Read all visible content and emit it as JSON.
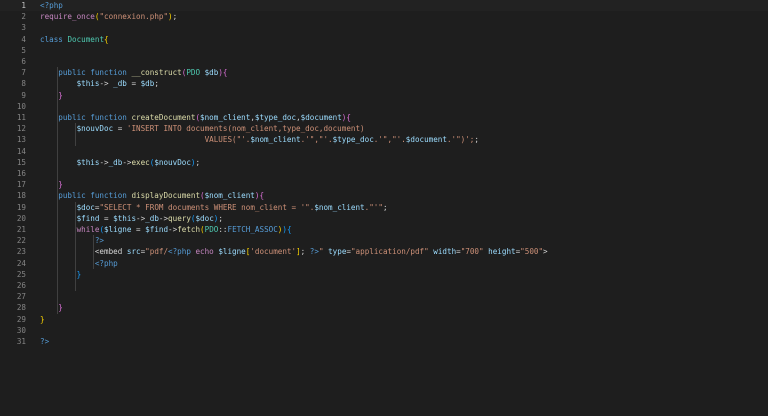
{
  "editor": {
    "language": "php",
    "active_line": 1,
    "colors": {
      "background": "#1e1e1e",
      "line_number": "#858585",
      "keyword": "#569cd6",
      "function": "#dcdcaa",
      "variable": "#9cdcfe",
      "string": "#ce9178",
      "control": "#c586c0"
    },
    "lines": [
      {
        "n": "1",
        "segments": [
          {
            "t": "<?php",
            "c": "kw"
          }
        ]
      },
      {
        "n": "2",
        "segments": [
          {
            "t": "require_once",
            "c": "ctl"
          },
          {
            "t": "(",
            "c": "br1"
          },
          {
            "t": "\"connexion.php\"",
            "c": "str"
          },
          {
            "t": ")",
            "c": "br1"
          },
          {
            "t": ";",
            "c": "pl"
          }
        ]
      },
      {
        "n": "3",
        "segments": []
      },
      {
        "n": "4",
        "segments": [
          {
            "t": "class ",
            "c": "kw"
          },
          {
            "t": "Document",
            "c": "cls"
          },
          {
            "t": "{",
            "c": "br1"
          }
        ]
      },
      {
        "n": "5",
        "segments": []
      },
      {
        "n": "6",
        "segments": []
      },
      {
        "n": "7",
        "segments": [
          {
            "t": "    public function ",
            "c": "kw"
          },
          {
            "t": "__construct",
            "c": "fn"
          },
          {
            "t": "(",
            "c": "br2"
          },
          {
            "t": "PDO ",
            "c": "cls"
          },
          {
            "t": "$db",
            "c": "var"
          },
          {
            "t": "){",
            "c": "br2"
          }
        ]
      },
      {
        "n": "8",
        "segments": [
          {
            "t": "        $this",
            "c": "var"
          },
          {
            "t": "-> ",
            "c": "op"
          },
          {
            "t": "_db",
            "c": "var"
          },
          {
            "t": " = ",
            "c": "op"
          },
          {
            "t": "$db",
            "c": "var"
          },
          {
            "t": ";",
            "c": "pl"
          }
        ]
      },
      {
        "n": "9",
        "segments": [
          {
            "t": "    }",
            "c": "br2"
          }
        ]
      },
      {
        "n": "10",
        "segments": []
      },
      {
        "n": "11",
        "segments": [
          {
            "t": "    public function ",
            "c": "kw"
          },
          {
            "t": "createDocument",
            "c": "fn"
          },
          {
            "t": "(",
            "c": "br2"
          },
          {
            "t": "$nom_client",
            "c": "var"
          },
          {
            "t": ",",
            "c": "pl"
          },
          {
            "t": "$type_doc",
            "c": "var"
          },
          {
            "t": ",",
            "c": "pl"
          },
          {
            "t": "$document",
            "c": "var"
          },
          {
            "t": "){",
            "c": "br2"
          }
        ]
      },
      {
        "n": "12",
        "segments": [
          {
            "t": "        $nouvDoc",
            "c": "var"
          },
          {
            "t": " = ",
            "c": "op"
          },
          {
            "t": "'INSERT INTO documents(nom_client,type_doc,document)",
            "c": "str"
          }
        ]
      },
      {
        "n": "13",
        "segments": [
          {
            "t": "                                    VALUES(\"'.",
            "c": "str"
          },
          {
            "t": "$nom_client",
            "c": "var"
          },
          {
            "t": ".'\",\"'.",
            "c": "str"
          },
          {
            "t": "$type_doc",
            "c": "var"
          },
          {
            "t": ".'\",\"'.",
            "c": "str"
          },
          {
            "t": "$document",
            "c": "var"
          },
          {
            "t": ".'\")';",
            "c": "str"
          },
          {
            "t": ";",
            "c": "pl"
          }
        ]
      },
      {
        "n": "14",
        "segments": []
      },
      {
        "n": "15",
        "segments": [
          {
            "t": "        $this",
            "c": "var"
          },
          {
            "t": "->",
            "c": "op"
          },
          {
            "t": "_db",
            "c": "var"
          },
          {
            "t": "->",
            "c": "op"
          },
          {
            "t": "exec",
            "c": "fn"
          },
          {
            "t": "(",
            "c": "br3"
          },
          {
            "t": "$nouvDoc",
            "c": "var"
          },
          {
            "t": ")",
            "c": "br3"
          },
          {
            "t": ";",
            "c": "pl"
          }
        ]
      },
      {
        "n": "16",
        "segments": []
      },
      {
        "n": "17",
        "segments": [
          {
            "t": "    }",
            "c": "br2"
          }
        ]
      },
      {
        "n": "18",
        "segments": [
          {
            "t": "    public function ",
            "c": "kw"
          },
          {
            "t": "displayDocument",
            "c": "fn"
          },
          {
            "t": "(",
            "c": "br2"
          },
          {
            "t": "$nom_client",
            "c": "var"
          },
          {
            "t": "){",
            "c": "br2"
          }
        ]
      },
      {
        "n": "19",
        "segments": [
          {
            "t": "        $doc",
            "c": "var"
          },
          {
            "t": "=",
            "c": "op"
          },
          {
            "t": "\"SELECT * FROM documents WHERE nom_client = '\".",
            "c": "str"
          },
          {
            "t": "$nom_client",
            "c": "var"
          },
          {
            "t": ".\"'\"",
            "c": "str"
          },
          {
            "t": ";",
            "c": "pl"
          }
        ]
      },
      {
        "n": "20",
        "segments": [
          {
            "t": "        $find",
            "c": "var"
          },
          {
            "t": " = ",
            "c": "op"
          },
          {
            "t": "$this",
            "c": "var"
          },
          {
            "t": "->",
            "c": "op"
          },
          {
            "t": "_db",
            "c": "var"
          },
          {
            "t": "->",
            "c": "op"
          },
          {
            "t": "query",
            "c": "fn"
          },
          {
            "t": "(",
            "c": "br3"
          },
          {
            "t": "$doc",
            "c": "var"
          },
          {
            "t": ")",
            "c": "br3"
          },
          {
            "t": ";",
            "c": "pl"
          }
        ]
      },
      {
        "n": "21",
        "segments": [
          {
            "t": "        while",
            "c": "ctl"
          },
          {
            "t": "(",
            "c": "br3"
          },
          {
            "t": "$ligne",
            "c": "var"
          },
          {
            "t": " = ",
            "c": "op"
          },
          {
            "t": "$find",
            "c": "var"
          },
          {
            "t": "->",
            "c": "op"
          },
          {
            "t": "fetch",
            "c": "fn"
          },
          {
            "t": "(",
            "c": "br1"
          },
          {
            "t": "PDO",
            "c": "cls"
          },
          {
            "t": "::",
            "c": "op"
          },
          {
            "t": "FETCH_ASSOC",
            "c": "kw"
          },
          {
            "t": ")",
            "c": "br1"
          },
          {
            "t": ")",
            "c": "br3"
          },
          {
            "t": "{",
            "c": "br3"
          }
        ]
      },
      {
        "n": "22",
        "segments": [
          {
            "t": "            ?>",
            "c": "kw"
          }
        ]
      },
      {
        "n": "23",
        "segments": [
          {
            "t": "            <embed ",
            "c": "pl"
          },
          {
            "t": "src",
            "c": "var"
          },
          {
            "t": "=",
            "c": "op"
          },
          {
            "t": "\"pdf/",
            "c": "str"
          },
          {
            "t": "<?php ",
            "c": "kw"
          },
          {
            "t": "echo ",
            "c": "ctl"
          },
          {
            "t": "$ligne",
            "c": "var"
          },
          {
            "t": "[",
            "c": "br1"
          },
          {
            "t": "'document'",
            "c": "str"
          },
          {
            "t": "]",
            "c": "br1"
          },
          {
            "t": "; ",
            "c": "pl"
          },
          {
            "t": "?>",
            "c": "kw"
          },
          {
            "t": "\" ",
            "c": "str"
          },
          {
            "t": "type",
            "c": "var"
          },
          {
            "t": "=",
            "c": "op"
          },
          {
            "t": "\"application/pdf\" ",
            "c": "str"
          },
          {
            "t": "width",
            "c": "var"
          },
          {
            "t": "=",
            "c": "op"
          },
          {
            "t": "\"700\" ",
            "c": "str"
          },
          {
            "t": "height",
            "c": "var"
          },
          {
            "t": "=",
            "c": "op"
          },
          {
            "t": "\"500\"",
            "c": "str"
          },
          {
            "t": ">",
            "c": "pl"
          }
        ]
      },
      {
        "n": "24",
        "segments": [
          {
            "t": "            <?php",
            "c": "kw"
          }
        ]
      },
      {
        "n": "25",
        "segments": [
          {
            "t": "        }",
            "c": "br3"
          }
        ]
      },
      {
        "n": "26",
        "segments": []
      },
      {
        "n": "27",
        "segments": []
      },
      {
        "n": "28",
        "segments": [
          {
            "t": "    }",
            "c": "br2"
          }
        ]
      },
      {
        "n": "29",
        "segments": [
          {
            "t": "}",
            "c": "br1"
          }
        ]
      },
      {
        "n": "30",
        "segments": []
      },
      {
        "n": "31",
        "segments": [
          {
            "t": "?>",
            "c": "kw"
          }
        ]
      }
    ]
  }
}
